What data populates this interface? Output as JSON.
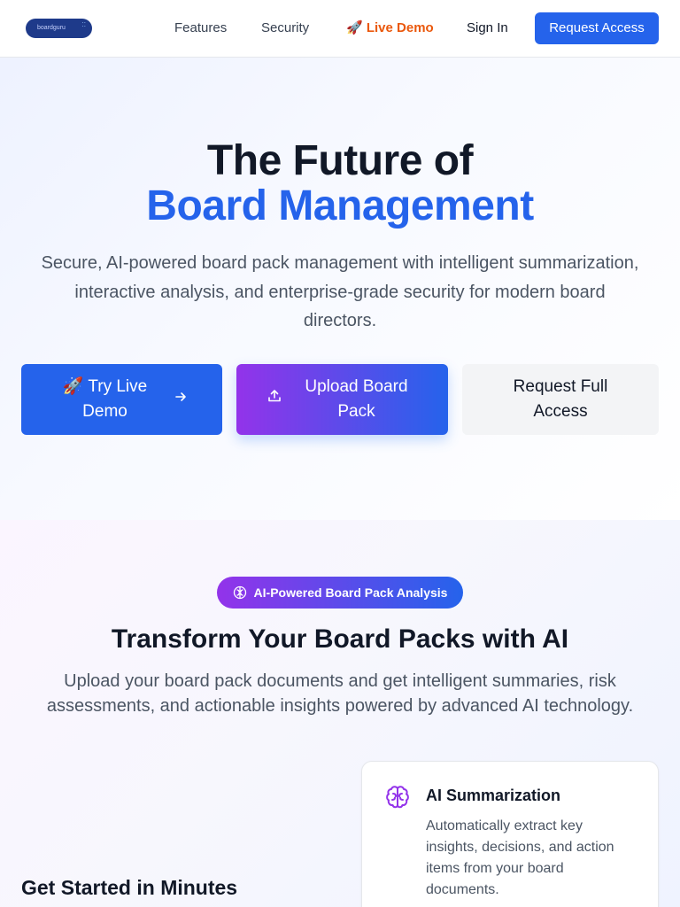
{
  "nav": {
    "logo_text": "boardguru",
    "links": [
      "Features",
      "Security"
    ],
    "live_demo": "🚀 Live Demo",
    "sign_in": "Sign In",
    "cta": "Request Access"
  },
  "hero": {
    "title_line1": "The Future of",
    "title_line2": "Board Management",
    "subtitle": "Secure, AI-powered board pack management with intelligent summarization, interactive analysis, and enterprise-grade security for modern board directors.",
    "buttons": {
      "demo": "🚀 Try Live Demo",
      "upload": "Upload Board Pack",
      "access": "Request Full Access"
    }
  },
  "ai_section": {
    "badge": "AI-Powered Board Pack Analysis",
    "title": "Transform Your Board Packs with AI",
    "subtitle": "Upload your board pack documents and get intelligent summaries, risk assessments, and actionable insights powered by advanced AI technology.",
    "get_started": "Get Started in Minutes",
    "card": {
      "icon": "brain-icon",
      "title": "AI Summarization",
      "description": "Automatically extract key insights, decisions, and action items from your board documents."
    }
  },
  "colors": {
    "primary": "#2563eb",
    "purple": "#9333ea",
    "demo_orange": "#ea580c"
  }
}
